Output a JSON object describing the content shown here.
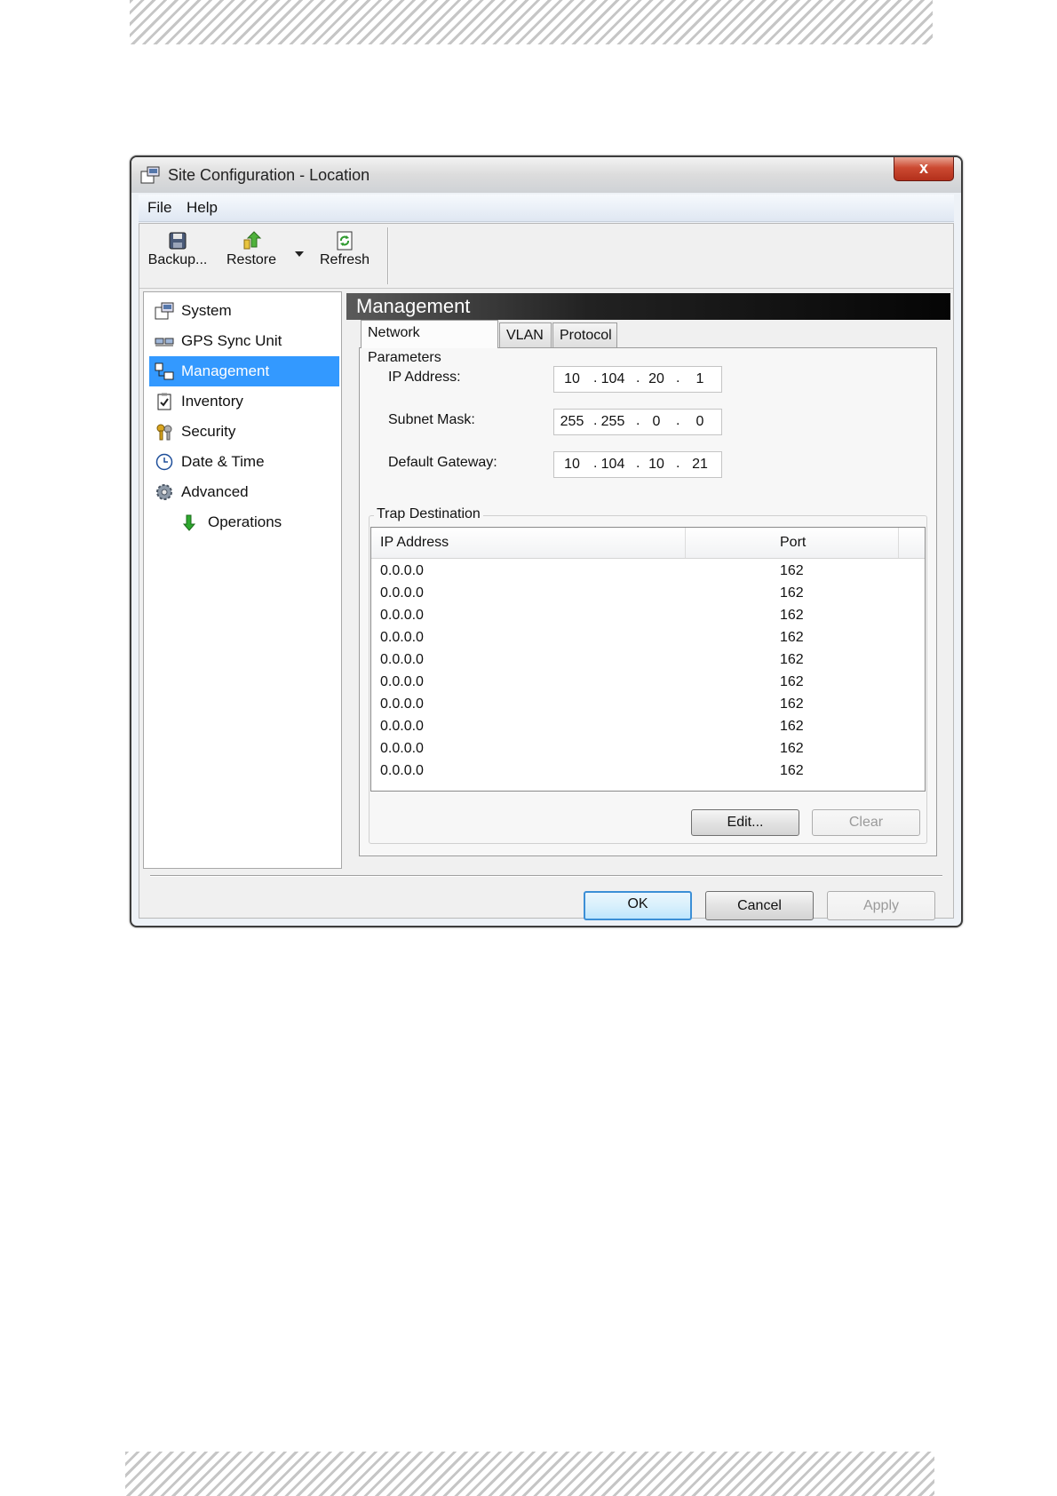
{
  "window": {
    "title": "Site Configuration - Location",
    "close_glyph": "x"
  },
  "menu": [
    "File",
    "Help"
  ],
  "toolbar": {
    "backup": "Backup...",
    "restore": "Restore",
    "refresh": "Refresh"
  },
  "nav": {
    "items": [
      {
        "label": "System",
        "icon": "system-icon"
      },
      {
        "label": "GPS Sync Unit",
        "icon": "gps-icon"
      },
      {
        "label": "Management",
        "icon": "management-icon",
        "selected": true
      },
      {
        "label": "Inventory",
        "icon": "inventory-icon"
      },
      {
        "label": "Security",
        "icon": "security-icon"
      },
      {
        "label": "Date & Time",
        "icon": "clock-icon"
      },
      {
        "label": "Advanced",
        "icon": "gear-icon"
      },
      {
        "label": "Operations",
        "icon": "arrow-down-icon"
      }
    ]
  },
  "pane": {
    "header": "Management",
    "tabs": [
      "Network Parameters",
      "VLAN",
      "Protocol"
    ],
    "ip_address": {
      "label": "IP Address:",
      "octets": [
        "10",
        "104",
        "20",
        "1"
      ]
    },
    "subnet_mask": {
      "label": "Subnet Mask:",
      "octets": [
        "255",
        "255",
        "0",
        "0"
      ]
    },
    "default_gateway": {
      "label": "Default Gateway:",
      "octets": [
        "10",
        "104",
        "10",
        "21"
      ]
    },
    "trap": {
      "legend": "Trap Destination",
      "columns": [
        "IP Address",
        "Port"
      ],
      "rows": [
        [
          "0.0.0.0",
          "162"
        ],
        [
          "0.0.0.0",
          "162"
        ],
        [
          "0.0.0.0",
          "162"
        ],
        [
          "0.0.0.0",
          "162"
        ],
        [
          "0.0.0.0",
          "162"
        ],
        [
          "0.0.0.0",
          "162"
        ],
        [
          "0.0.0.0",
          "162"
        ],
        [
          "0.0.0.0",
          "162"
        ],
        [
          "0.0.0.0",
          "162"
        ],
        [
          "0.0.0.0",
          "162"
        ]
      ],
      "edit": "Edit...",
      "clear": "Clear"
    }
  },
  "buttons": {
    "ok": "OK",
    "cancel": "Cancel",
    "apply": "Apply"
  },
  "colors": {
    "selection": "#3399ff",
    "header_bg": "#111111"
  }
}
